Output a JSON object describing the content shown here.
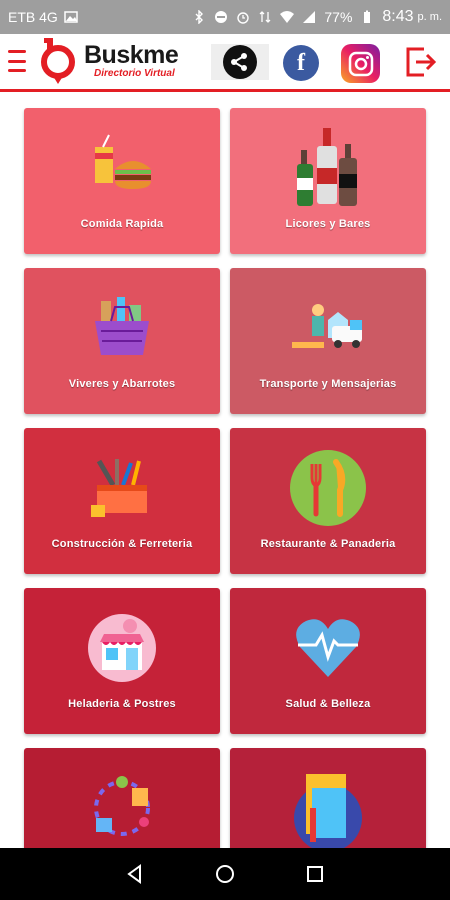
{
  "status_bar": {
    "carrier": "ETB 4G",
    "battery": "77%",
    "time": "8:43",
    "ampm": "p. m."
  },
  "header": {
    "brand_name": "Buskme",
    "brand_tagline": "Directorio Virtual",
    "accent_color": "#e31e24"
  },
  "categories": [
    {
      "label": "Comida Rapida",
      "icon": "fast-food-icon",
      "color": "#f2606c"
    },
    {
      "label": "Licores y Bares",
      "icon": "liquor-bottles-icon",
      "color": "#f26f7c"
    },
    {
      "label": "Viveres y Abarrotes",
      "icon": "grocery-basket-icon",
      "color": "#e0525f"
    },
    {
      "label": "Transporte y Mensajerias",
      "icon": "transport-icon",
      "color": "#cc5a64"
    },
    {
      "label": "Construcción & Ferreteria",
      "icon": "tools-box-icon",
      "color": "#d12f3f"
    },
    {
      "label": "Restaurante & Panaderia",
      "icon": "fork-knife-icon",
      "color": "#c73344"
    },
    {
      "label": "Heladeria & Postres",
      "icon": "ice-cream-shop-icon",
      "color": "#c52238"
    },
    {
      "label": "Salud & Belleza",
      "icon": "heart-pulse-icon",
      "color": "#c0283d"
    },
    {
      "label": "",
      "icon": "party-items-icon",
      "color": "#b61d33"
    },
    {
      "label": "",
      "icon": "stationery-icon",
      "color": "#b5213a"
    }
  ]
}
